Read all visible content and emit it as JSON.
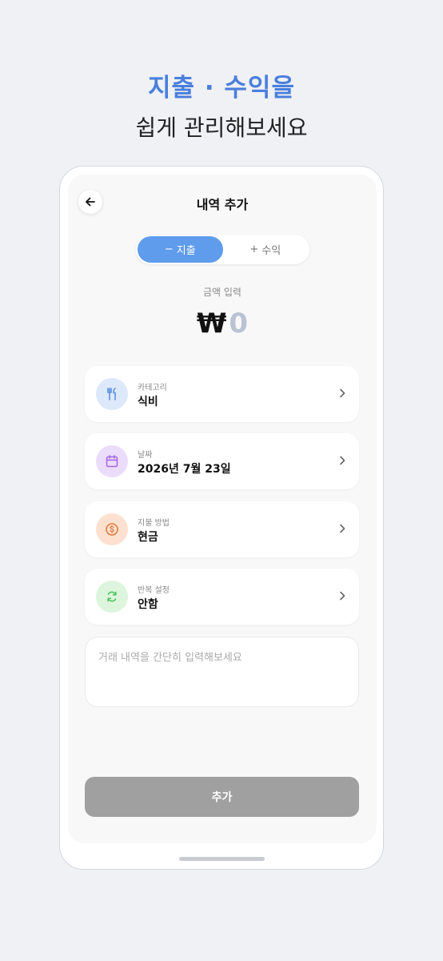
{
  "promo": {
    "title": "지출 · 수익을",
    "subtitle": "쉽게 관리해보세요"
  },
  "header": {
    "title": "내역 추가",
    "back_icon": "arrow-left-icon"
  },
  "type_toggle": {
    "expense_label": "지출",
    "income_label": "수익",
    "selected": "expense"
  },
  "amount": {
    "label": "금액 입력",
    "currency": "₩",
    "value": "0"
  },
  "fields": [
    {
      "label": "카테고리",
      "value": "식비",
      "icon": "fork-knife-icon",
      "icon_bg": "#dde8fb",
      "icon_color": "#5b8fe0"
    },
    {
      "label": "날짜",
      "value": "2026년 7월 23일",
      "icon": "calendar-icon",
      "icon_bg": "#ecdcfb",
      "icon_color": "#a466e8"
    },
    {
      "label": "지불 방법",
      "value": "현금",
      "icon": "coin-icon",
      "icon_bg": "#fde0d0",
      "icon_color": "#e57a3a"
    },
    {
      "label": "반복 설정",
      "value": "안함",
      "icon": "repeat-icon",
      "icon_bg": "#dcf5dc",
      "icon_color": "#48c35a"
    }
  ],
  "memo": {
    "placeholder": "거래 내역을 간단히 입력해보세요",
    "value": ""
  },
  "submit": {
    "label": "추가"
  },
  "colors": {
    "accent": "#5f9ceb",
    "promo_title": "#4a7fdc",
    "submit_disabled": "#a0a0a0"
  }
}
